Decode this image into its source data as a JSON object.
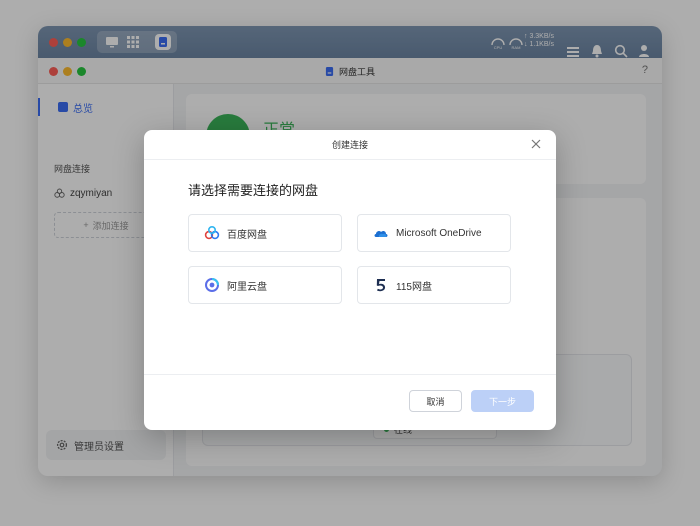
{
  "app": {
    "title": "网盘工具",
    "help_label": "?"
  },
  "system": {
    "net_up": "3.3KB/s",
    "net_down": "1.1KB/s",
    "cpu_label": "CPU",
    "ram_label": "RAM"
  },
  "sidebar": {
    "overview_label": "总览",
    "section_title": "网盘连接",
    "account_name": "zqymiyan",
    "add_label": "添加连接",
    "admin_label": "管理员设置"
  },
  "main": {
    "status_text": "正常",
    "online_label": "在线"
  },
  "modal": {
    "title": "创建连接",
    "prompt": "请选择需要连接的网盘",
    "options": [
      {
        "label": "百度网盘",
        "icon": "baidu-netdisk-icon"
      },
      {
        "label": "Microsoft OneDrive",
        "icon": "onedrive-icon"
      },
      {
        "label": "阿里云盘",
        "icon": "aliyun-drive-icon"
      },
      {
        "label": "115网盘",
        "icon": "115-icon"
      }
    ],
    "cancel_label": "取消",
    "next_label": "下一步"
  },
  "colors": {
    "accent": "#3b6ef5",
    "status_green": "#3bb55a",
    "next_disabled": "#bcd0f7"
  }
}
